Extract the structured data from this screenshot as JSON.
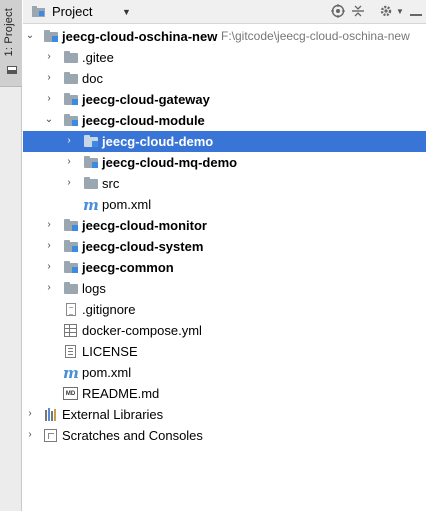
{
  "side_tab": {
    "label": "1: Project"
  },
  "header": {
    "title": "Project",
    "icons": [
      "globe-target-icon",
      "collapse-icon",
      "gear-icon",
      "hide-icon"
    ]
  },
  "tree": [
    {
      "label": "jeecg-cloud-oschina-new",
      "path": "F:\\gitcode\\jeecg-cloud-oschina-new",
      "icon": "module-folder",
      "bold": true,
      "expanded": true
    },
    {
      "label": ".gitee",
      "icon": "folder"
    },
    {
      "label": "doc",
      "icon": "folder"
    },
    {
      "label": "jeecg-cloud-gateway",
      "icon": "module-folder",
      "bold": true
    },
    {
      "label": "jeecg-cloud-module",
      "icon": "module-folder",
      "bold": true,
      "expanded": true
    },
    {
      "label": "jeecg-cloud-demo",
      "icon": "module-folder",
      "bold": true,
      "selected": true
    },
    {
      "label": "jeecg-cloud-mq-demo",
      "icon": "module-folder",
      "bold": true
    },
    {
      "label": "src",
      "icon": "folder"
    },
    {
      "label": "pom.xml",
      "icon": "maven"
    },
    {
      "label": "jeecg-cloud-monitor",
      "icon": "module-folder",
      "bold": true
    },
    {
      "label": "jeecg-cloud-system",
      "icon": "module-folder",
      "bold": true
    },
    {
      "label": "jeecg-common",
      "icon": "module-folder",
      "bold": true
    },
    {
      "label": "logs",
      "icon": "folder"
    },
    {
      "label": ".gitignore",
      "icon": "file"
    },
    {
      "label": "docker-compose.yml",
      "icon": "yaml"
    },
    {
      "label": "LICENSE",
      "icon": "license"
    },
    {
      "label": "pom.xml",
      "icon": "maven"
    },
    {
      "label": "README.md",
      "icon": "markdown"
    },
    {
      "label": "External Libraries",
      "icon": "libraries"
    },
    {
      "label": "Scratches and Consoles",
      "icon": "scratches"
    }
  ]
}
